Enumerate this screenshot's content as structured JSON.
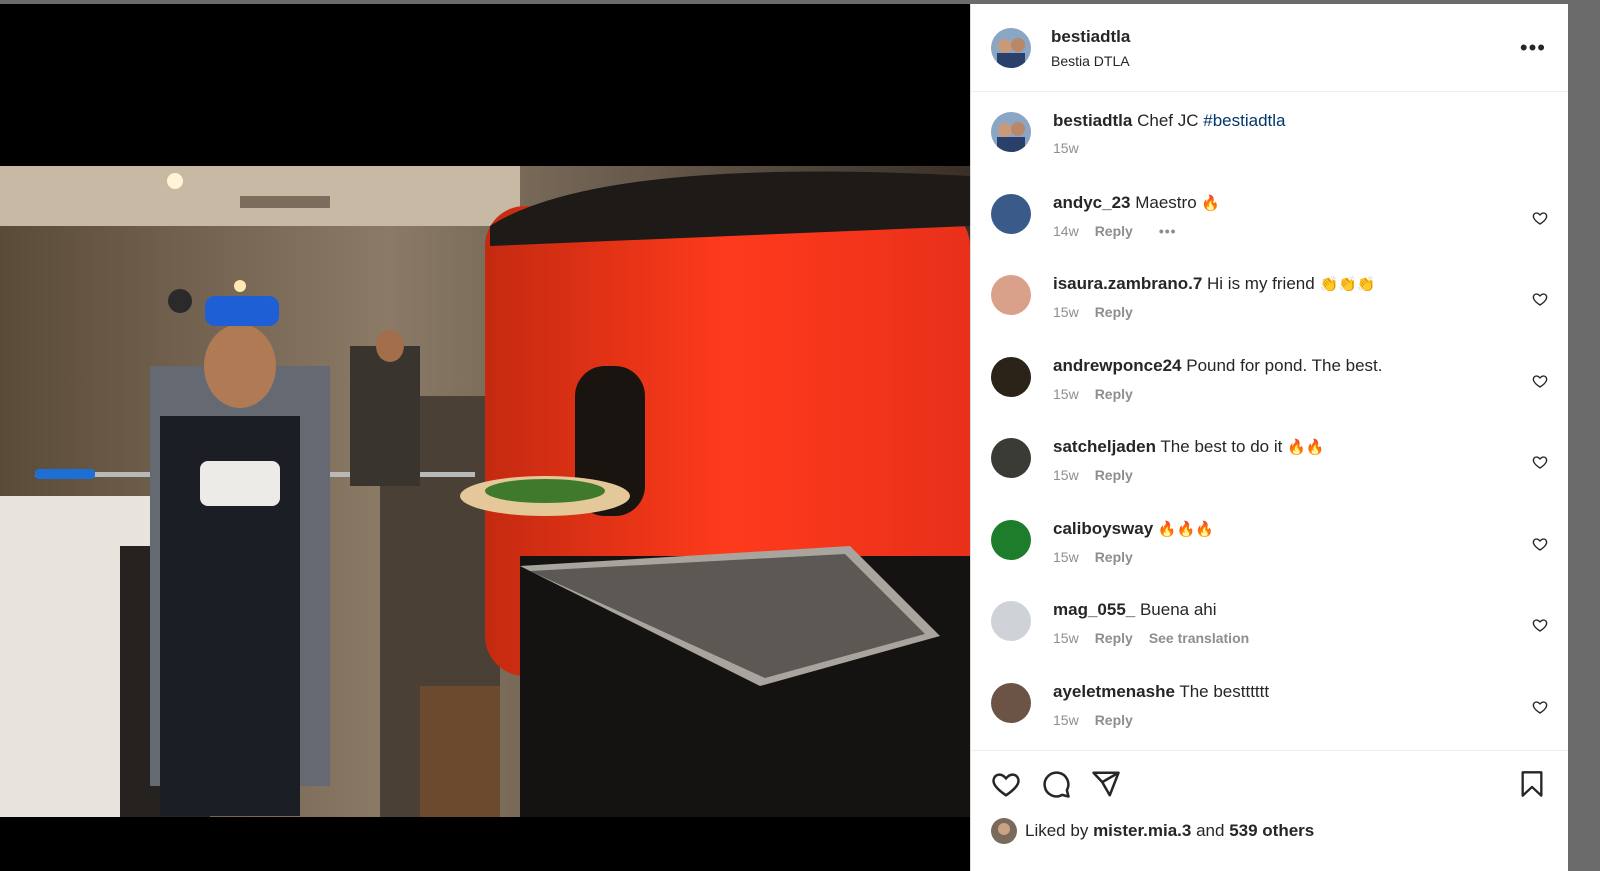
{
  "post": {
    "username": "bestiadtla",
    "location": "Bestia DTLA",
    "caption_text": "Chef JC",
    "caption_tag": "#bestiadtla",
    "caption_time": "15w"
  },
  "comments": [
    {
      "user": "andyc_23",
      "text": "Maestro",
      "emoji": "🔥",
      "time": "14w",
      "reply": "Reply",
      "more": "•••",
      "avatar": "#3a5a8a"
    },
    {
      "user": "isaura.zambrano.7",
      "text": "Hi is my friend",
      "emoji": "👏👏👏",
      "time": "15w",
      "reply": "Reply",
      "avatar": "#d9a08a"
    },
    {
      "user": "andrewponce24",
      "text": "Pound for pond. The best.",
      "emoji": "",
      "time": "15w",
      "reply": "Reply",
      "avatar": "#2b2218"
    },
    {
      "user": "satcheljaden",
      "text": "The best to do it",
      "emoji": "🔥🔥",
      "time": "15w",
      "reply": "Reply",
      "avatar": "#3b3b36"
    },
    {
      "user": "caliboysway",
      "text": "",
      "emoji": "🔥🔥🔥",
      "time": "15w",
      "reply": "Reply",
      "avatar": "#1e7d2a"
    },
    {
      "user": "mag_055_",
      "text": "Buena ahi",
      "emoji": "",
      "time": "15w",
      "reply": "Reply",
      "translate": "See translation",
      "avatar": "#cfd3d8"
    },
    {
      "user": "ayeletmenashe",
      "text": "The bestttttt",
      "emoji": "",
      "time": "15w",
      "reply": "Reply",
      "avatar": "#6b5346"
    }
  ],
  "likes": {
    "prefix": "Liked by",
    "user": "mister.mia.3",
    "joiner": "and",
    "count": "539 others"
  },
  "icons": {
    "like": "heart-icon",
    "comment": "comment-icon",
    "share": "share-icon",
    "save": "bookmark-icon",
    "more": "more-icon"
  },
  "colors": {
    "text": "#262626",
    "muted": "#8e8e8e",
    "hashtag": "#00376b"
  }
}
